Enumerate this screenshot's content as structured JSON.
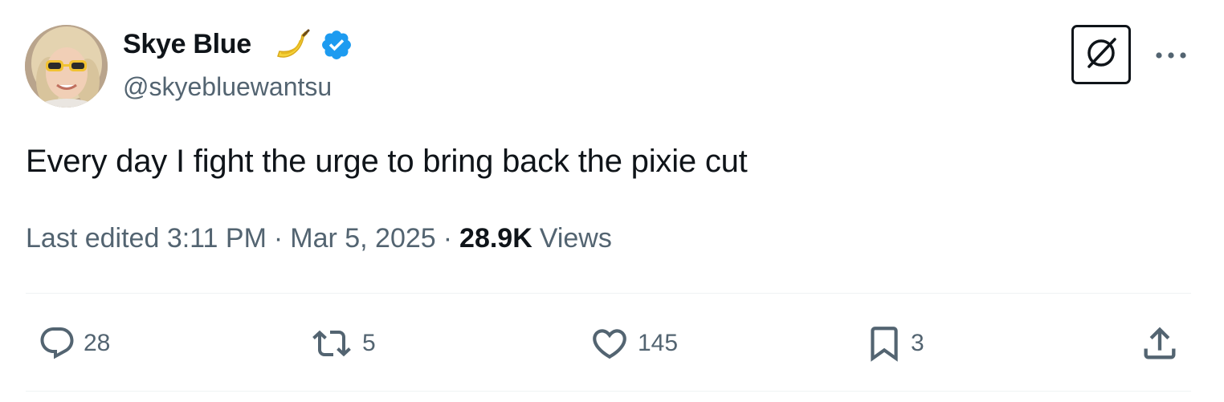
{
  "author": {
    "display_name": "Skye Blue",
    "name_emoji": "banana-emoji",
    "verified_badge": "verified-badge-icon",
    "handle": "@skyebluewantsu",
    "avatar": "avatar-photo"
  },
  "header_actions": {
    "grok_icon": "grok-icon",
    "more_icon": "more-icon"
  },
  "tweet": {
    "text": "Every day I fight the urge to bring back the pixie cut"
  },
  "meta": {
    "edited_label": "Last edited",
    "time": "3:11 PM",
    "separator": "·",
    "date": "Mar 5, 2025",
    "views_count": "28.9K",
    "views_label": "Views"
  },
  "actions": {
    "replies": "28",
    "reposts": "5",
    "likes": "145",
    "bookmarks": "3",
    "share_icon": "share-icon"
  },
  "colors": {
    "text_primary": "#0f1419",
    "text_secondary": "#536471",
    "verified_blue": "#1d9bf0",
    "divider": "#eff3f4"
  }
}
